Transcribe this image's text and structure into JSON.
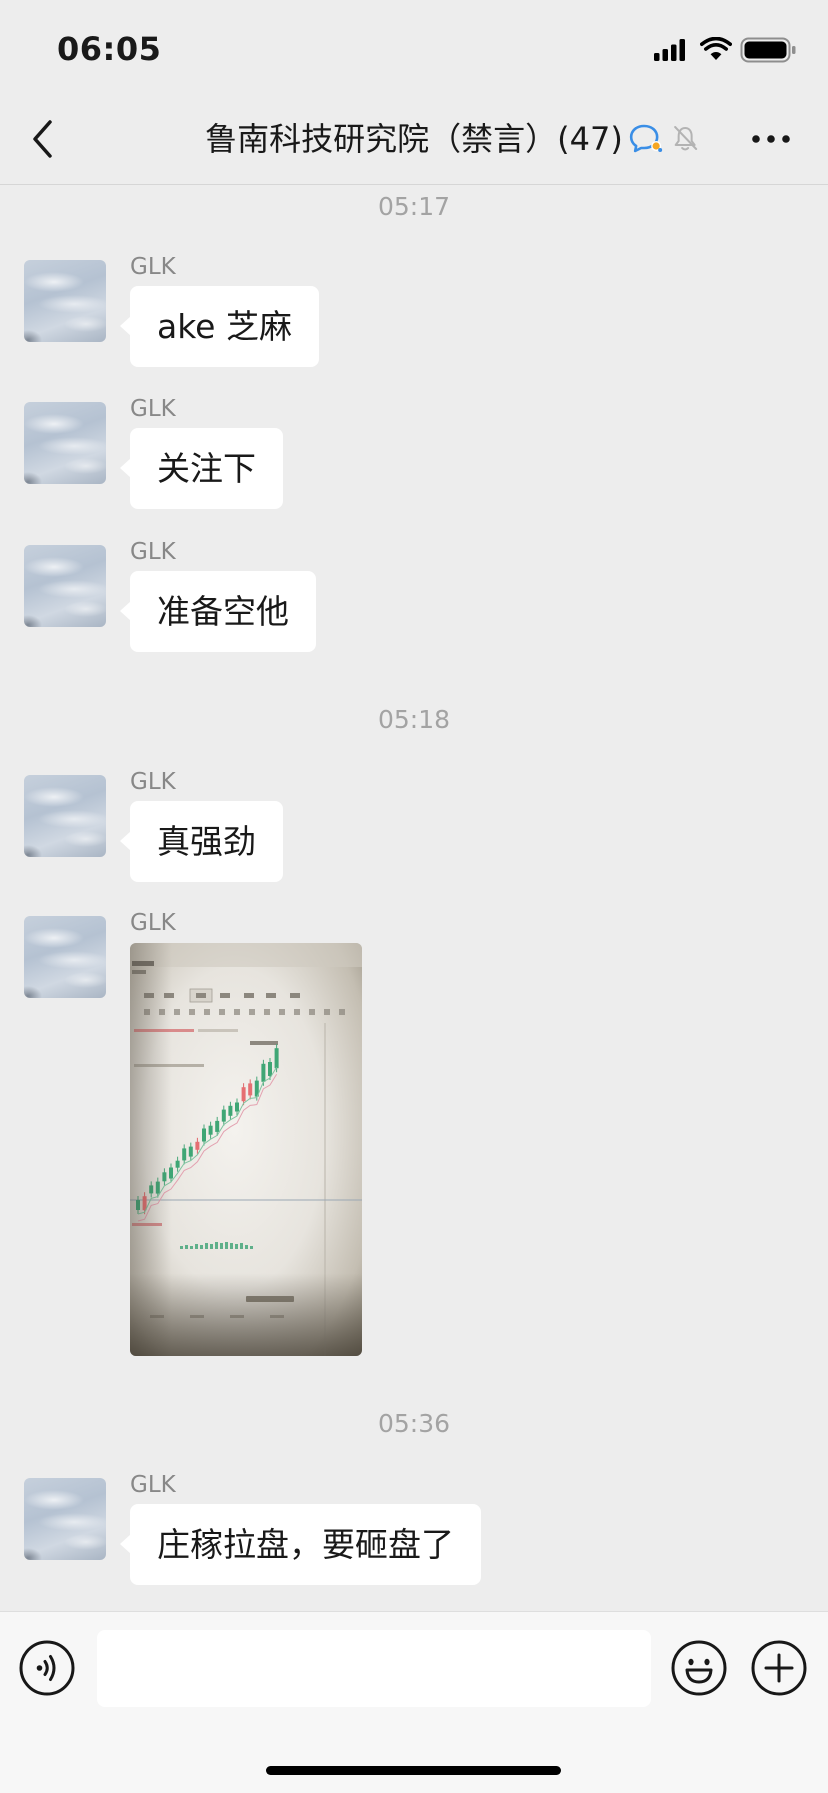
{
  "status_bar": {
    "time": "06:05",
    "icons": [
      "signal-icon",
      "wifi-icon",
      "battery-icon"
    ]
  },
  "nav": {
    "title": "鲁南科技研究院（禁言）(47)",
    "icons": {
      "back": "chevron-left-icon",
      "title_badges": [
        "chat-bubble-icon",
        "mute-bell-icon"
      ],
      "more": "more-dots-icon"
    }
  },
  "chat": {
    "timestamps": [
      "05:17",
      "05:18",
      "05:36"
    ],
    "messages": [
      {
        "sender": "GLK",
        "type": "text",
        "text": "ake 芝麻"
      },
      {
        "sender": "GLK",
        "type": "text",
        "text": "关注下"
      },
      {
        "sender": "GLK",
        "type": "text",
        "text": "准备空他"
      },
      {
        "sender": "GLK",
        "type": "text",
        "text": "真强劲"
      },
      {
        "sender": "GLK",
        "type": "image"
      },
      {
        "sender": "GLK",
        "type": "text",
        "text": "庄稼拉盘，要砸盘了"
      }
    ]
  },
  "input_bar": {
    "icons": {
      "voice": "voice-icon",
      "emoji": "emoji-icon",
      "more": "plus-icon"
    }
  },
  "colors": {
    "background": "#ededed",
    "bubble": "#ffffff",
    "text": "#191919",
    "sender": "#888888",
    "timestamp": "#a3a3a3",
    "accent": "#3a8ee6",
    "input_bar": "#f7f7f7"
  }
}
